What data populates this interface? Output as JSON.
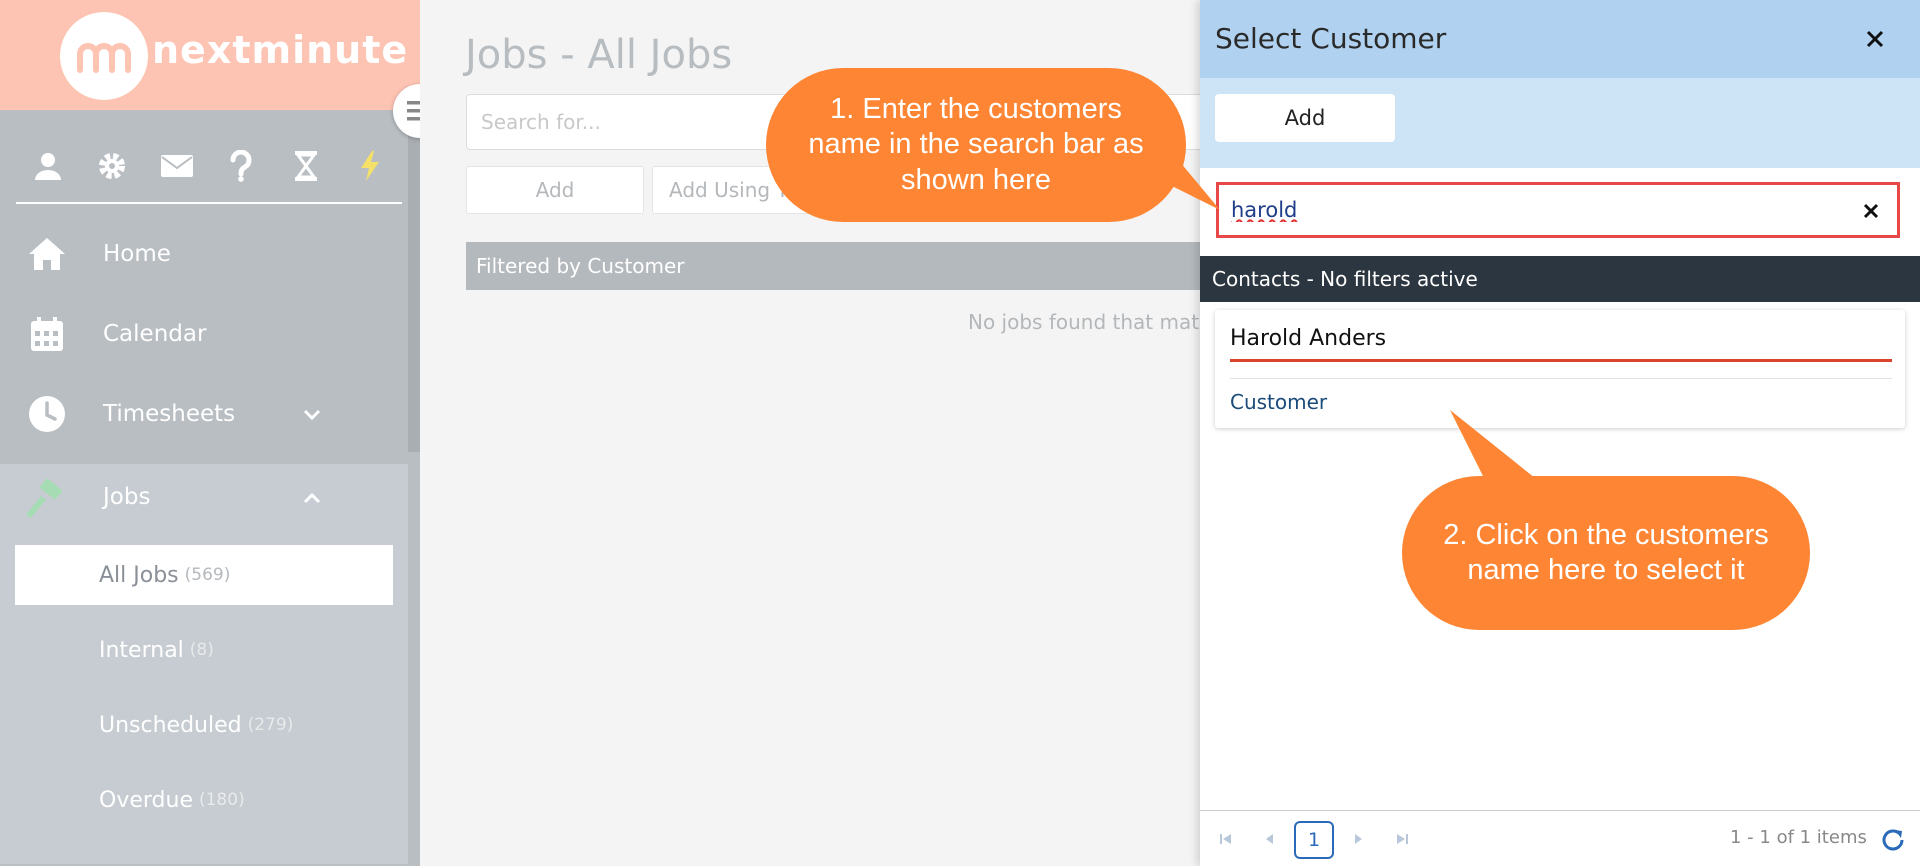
{
  "brand": {
    "logo_mark": "m",
    "logo_text": "nextminute"
  },
  "sidebar": {
    "top_icons": [
      "user-icon",
      "gear-icon",
      "envelope-icon",
      "question-icon",
      "hourglass-icon",
      "lightning-icon"
    ],
    "items": [
      {
        "label": "Home",
        "icon": "home-icon"
      },
      {
        "label": "Calendar",
        "icon": "calendar-icon"
      },
      {
        "label": "Timesheets",
        "icon": "clock-icon"
      },
      {
        "label": "Jobs",
        "icon": "hammer-icon"
      }
    ],
    "jobs_subitems": [
      {
        "label": "All Jobs",
        "count": "(569)"
      },
      {
        "label": "Internal",
        "count": "(8)"
      },
      {
        "label": "Unscheduled",
        "count": "(279)"
      },
      {
        "label": "Overdue",
        "count": "(180)"
      }
    ]
  },
  "main": {
    "title": "Jobs - All Jobs",
    "search_placeholder": "Search for...",
    "add_label": "Add",
    "add_using_label": "Add Using T",
    "filter_text": "Filtered by Customer",
    "empty_text": "No jobs found that match"
  },
  "panel": {
    "title": "Select Customer",
    "add_label": "Add",
    "search_value": "harold",
    "contacts_header": "Contacts - No filters active",
    "contact": {
      "name": "Harold Anders",
      "type": "Customer"
    },
    "pager": {
      "current_page": "1",
      "info": "1 - 1 of 1 items"
    }
  },
  "callouts": {
    "step1": "1. Enter the customers name in the search bar as shown here",
    "step2": "2. Click on the customers name here to select it"
  },
  "colors": {
    "accent_orange": "#fe8533",
    "panel_header": "#b0d2f0",
    "sidebar_bg": "#b9bec3",
    "logo_bg": "#fdc3b3",
    "highlight_red": "#e84848"
  }
}
